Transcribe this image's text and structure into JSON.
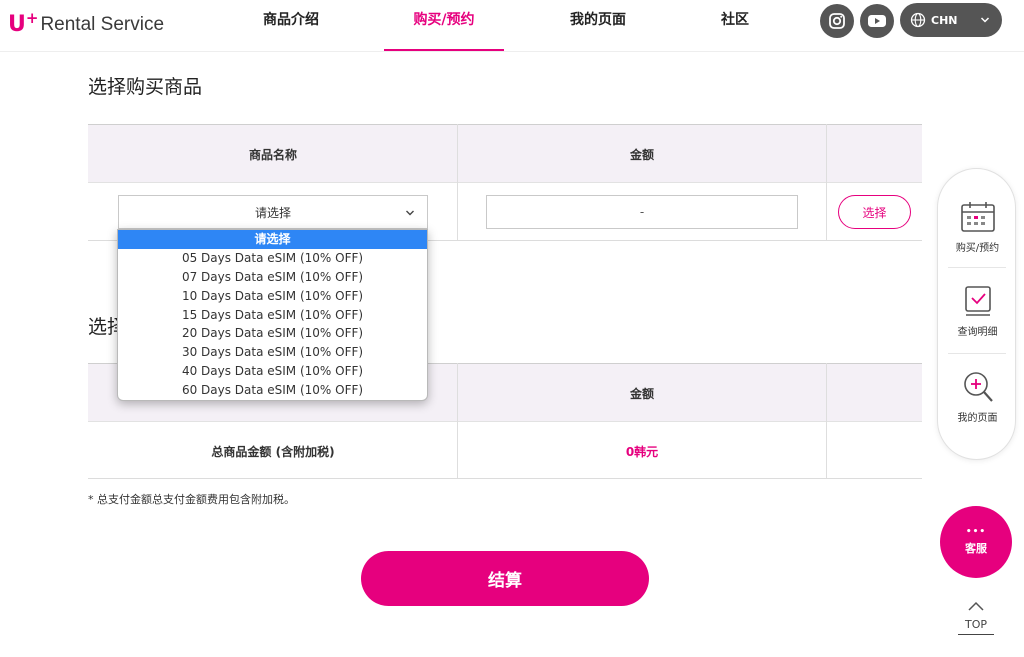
{
  "header": {
    "logo_mark": "U",
    "logo_plus": "+",
    "logo_text": "Rental Service",
    "nav": [
      {
        "label": "商品介绍"
      },
      {
        "label": "购买/预约",
        "active": true
      },
      {
        "label": "我的页面"
      },
      {
        "label": "社区"
      }
    ],
    "social_icons": [
      "instagram-icon",
      "youtube-icon"
    ],
    "lang": {
      "label": "CHN",
      "icon": "globe-icon"
    }
  },
  "section1": {
    "title": "选择购买商品",
    "col_product": "商品名称",
    "col_amount": "金额",
    "select_value": "请选择",
    "amount_value": "-",
    "select_button": "选择"
  },
  "dropdown": {
    "options": [
      "请选择",
      "05 Days Data eSIM (10% OFF)",
      "07 Days Data eSIM (10% OFF)",
      "10 Days Data eSIM (10% OFF)",
      "15 Days Data eSIM (10% OFF)",
      "20 Days Data eSIM (10% OFF)",
      "30 Days Data eSIM (10% OFF)",
      "40 Days Data eSIM (10% OFF)",
      "60 Days Data eSIM (10% OFF)"
    ],
    "selected_index": 0
  },
  "section2": {
    "title_partial": "选择",
    "col_amount": "金额",
    "total_label": "总商品金额 (含附加税)",
    "total_value": "0韩元"
  },
  "note": "* 总支付金额总支付金额费用包含附加税。",
  "pay_button": "结算",
  "side": {
    "items": [
      {
        "label": "购买/预约",
        "icon": "calendar-icon"
      },
      {
        "label": "查询明细",
        "icon": "checklist-icon"
      },
      {
        "label": "我的页面",
        "icon": "search-plus-icon"
      }
    ],
    "cs_dots": "•••",
    "cs_label": "客服",
    "top_label": "TOP"
  },
  "colors": {
    "accent": "#e6007e",
    "dropdown_selected": "#2e86f5",
    "header_icon_bg": "#555555",
    "table_head_bg": "#f4f0f6"
  }
}
